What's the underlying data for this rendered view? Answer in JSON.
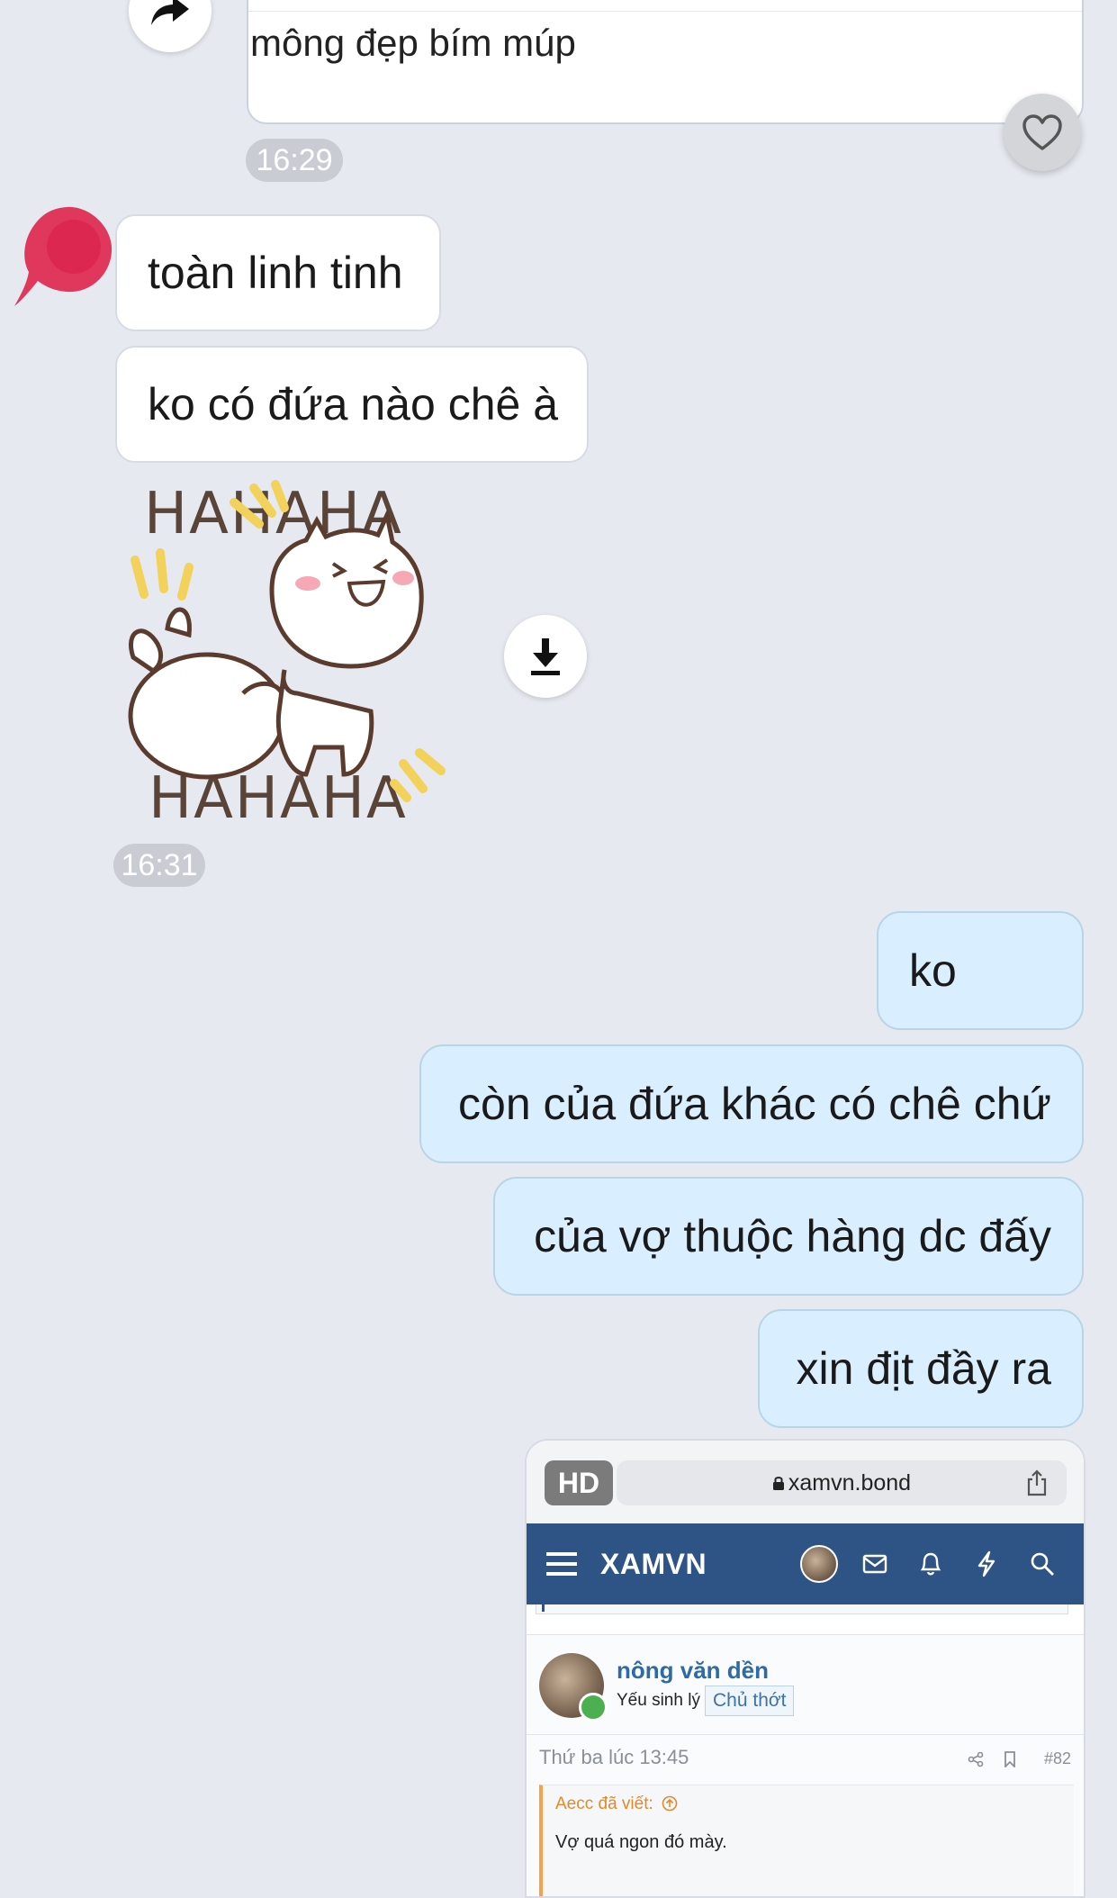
{
  "top_message": {
    "text": "mông đẹp bím múp",
    "time": "16:29"
  },
  "incoming": {
    "messages": [
      {
        "text": "toàn linh tinh"
      },
      {
        "text": "ko có đứa nào chê à"
      }
    ],
    "sticker": {
      "top_text": "HAHAHA",
      "bottom_text": "HAHAHA"
    },
    "time": "16:31"
  },
  "outgoing": {
    "messages": [
      {
        "text": "ko"
      },
      {
        "text": "còn của đứa khác có chê chứ"
      },
      {
        "text": "của vợ thuộc hàng dc đấy"
      },
      {
        "text": "xin địt đầy ra"
      }
    ]
  },
  "shared_screenshot": {
    "badge": "HD",
    "url": "xamvn.bond",
    "site_title": "XAMVN",
    "username": "nông văn dền",
    "user_title": "Yếu sinh lý",
    "user_badge": "Chủ thớt",
    "post_date": "Thứ ba lúc 13:45",
    "post_number": "#82",
    "quote_header": "Aecc đã viết:",
    "quote_body": "Vợ quá ngon đó mày."
  },
  "icons": {
    "forward": "forward-arrow-icon",
    "like": "heart-icon",
    "download": "download-icon",
    "avatar": "avatar-blob"
  },
  "colors": {
    "background": "#e6e9f0",
    "incoming_bubble": "#ffffff",
    "outgoing_bubble": "#d9efff",
    "timestamp": "#c9ccd2",
    "site_nav": "#2d5484",
    "avatar_red": "#e0284f"
  }
}
